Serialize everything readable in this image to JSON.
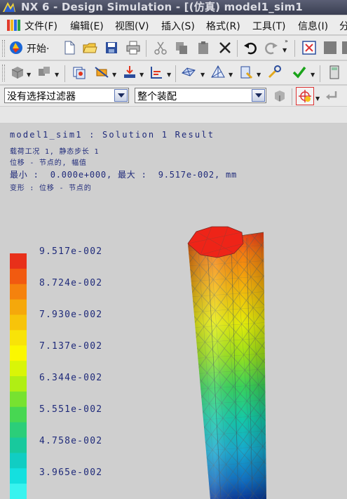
{
  "window": {
    "title": "NX 6 - Design Simulation - [(仿真) model1_sim1"
  },
  "menu": {
    "items": [
      {
        "label": "文件(F)"
      },
      {
        "label": "编辑(E)"
      },
      {
        "label": "视图(V)"
      },
      {
        "label": "插入(S)"
      },
      {
        "label": "格式(R)"
      },
      {
        "label": "工具(T)"
      },
      {
        "label": "信息(I)"
      },
      {
        "label": "分"
      }
    ]
  },
  "toolbar": {
    "start_label": "开始·",
    "selection_filter": "没有选择过滤器",
    "selection_scope": "整个装配"
  },
  "result": {
    "header_line1": "model1_sim1 : Solution 1 Result",
    "header_line2": "载荷工况 1, 静态步长 1",
    "header_line3": "位移 - 节点的, 幅值",
    "header_line4": "最小 :  0.000e+000, 最大 :  9.517e-002, mm",
    "header_line5": "变形 : 位移 - 节点的"
  },
  "legend": {
    "labels": [
      "9.517e-002",
      "8.724e-002",
      "7.930e-002",
      "7.137e-002",
      "6.344e-002",
      "5.551e-002",
      "4.758e-002",
      "3.965e-002"
    ],
    "colors": [
      "#e8301a",
      "#f15a10",
      "#f5820d",
      "#f5a80b",
      "#f7c40a",
      "#f8e308",
      "#fbf700",
      "#d9f507",
      "#b0ee14",
      "#77e230",
      "#47d752",
      "#2bce79",
      "#18c99d",
      "#11cdc3",
      "#14e0df",
      "#38f3ef"
    ]
  }
}
